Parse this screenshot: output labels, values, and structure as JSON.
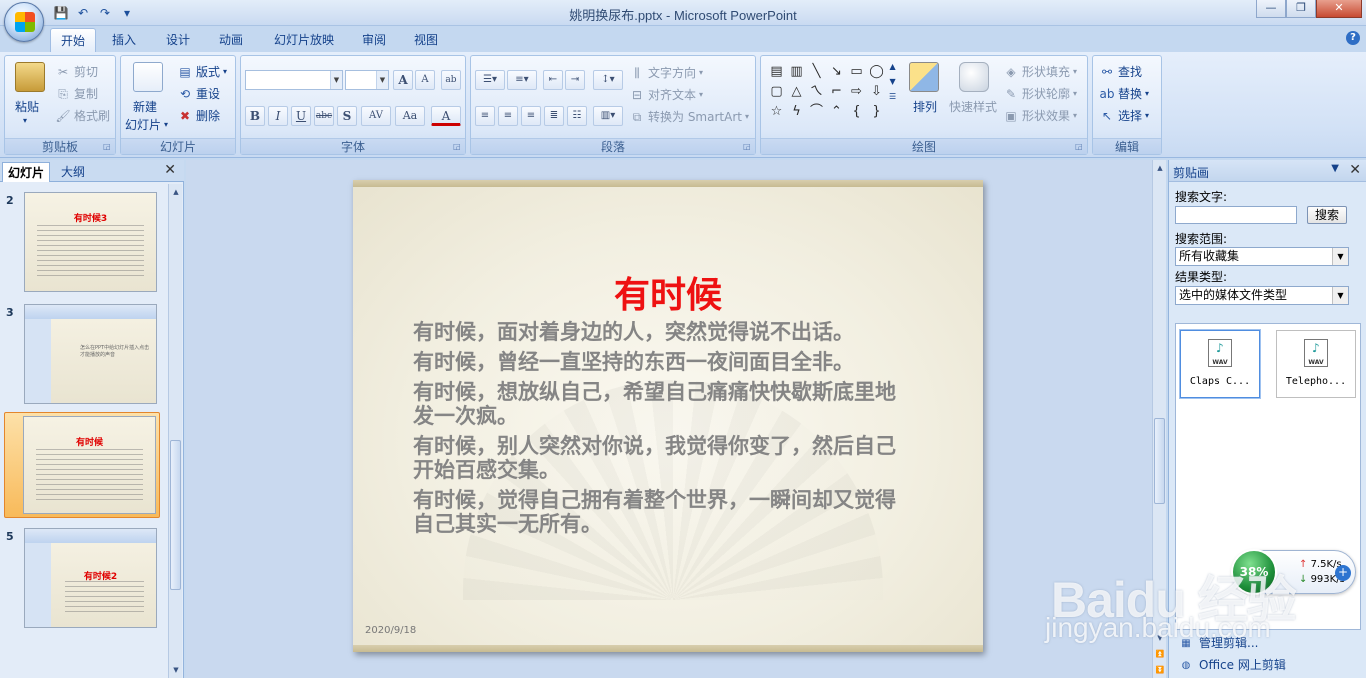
{
  "window": {
    "title": "姚明换尿布.pptx - Microsoft PowerPoint",
    "controls": {
      "minimize": "—",
      "maximize": "❐",
      "close": "✕"
    }
  },
  "qat": {
    "save": "💾",
    "undo": "↶",
    "redo": "↷",
    "more": "▾"
  },
  "tabs": [
    "开始",
    "插入",
    "设计",
    "动画",
    "幻灯片放映",
    "审阅",
    "视图"
  ],
  "active_tab": "开始",
  "help": "?",
  "ribbon": {
    "clipboard": {
      "label": "剪贴板",
      "paste": "粘贴",
      "cut": "剪切",
      "copy": "复制",
      "format_painter": "格式刷"
    },
    "slides": {
      "label": "幻灯片",
      "new_slide_1": "新建",
      "new_slide_2": "幻灯片",
      "layout": "版式",
      "reset": "重设",
      "delete": "删除"
    },
    "font": {
      "label": "字体",
      "bold": "B",
      "italic": "I",
      "underline": "U",
      "strike": "abc",
      "shadow": "S",
      "spacing": "AV",
      "case": "Aa",
      "color": "A",
      "grow": "A",
      "shrink": "A"
    },
    "paragraph": {
      "label": "段落",
      "text_direction": "文字方向",
      "align_text": "对齐文本",
      "smartart": "转换为 SmartArt"
    },
    "drawing": {
      "label": "绘图",
      "arrange": "排列",
      "quick_styles": "快速样式",
      "shape_fill": "形状填充",
      "shape_outline": "形状轮廓",
      "shape_effects": "形状效果"
    },
    "editing": {
      "label": "编辑",
      "find": "查找",
      "replace": "替换",
      "select": "选择"
    }
  },
  "left_pane": {
    "tabs": [
      "幻灯片",
      "大纲"
    ],
    "close": "✕",
    "thumbnails": [
      {
        "num": "2",
        "title": "有时候3"
      },
      {
        "num": "3",
        "title": "怎么在PPT中给幻灯片插入点击才能播放的声音"
      },
      {
        "num": "4",
        "title": "有时候",
        "selected": true
      },
      {
        "num": "5",
        "title": "有时候2"
      }
    ]
  },
  "slide": {
    "title": "有时候",
    "paragraphs": [
      "有时候，面对着身边的人，突然觉得说不出话。",
      "有时候，曾经一直坚持的东西一夜间面目全非。",
      "有时候，想放纵自己，希望自己痛痛快快歇斯底里地发一次疯。",
      "有时候，别人突然对你说，我觉得你变了，然后自己开始百感交集。",
      "有时候，觉得自己拥有着整个世界，一瞬间却又觉得自己其实一无所有。"
    ],
    "date": "2020/9/18"
  },
  "clip_pane": {
    "title": "剪贴画",
    "menu": "▼",
    "close": "✕",
    "search_label": "搜索文字:",
    "search_value": "",
    "search_button": "搜索",
    "scope_label": "搜索范围:",
    "scope_value": "所有收藏集",
    "type_label": "结果类型:",
    "type_value": "选中的媒体文件类型",
    "results": [
      {
        "caption": "Claps C...",
        "badge": "WAV"
      },
      {
        "caption": "Telepho...",
        "badge": "WAV"
      }
    ],
    "link_manage": "管理剪辑...",
    "link_online": "Office 网上剪辑"
  },
  "net_widget": {
    "percent": "38%",
    "up": "7.5K/s",
    "down": "993K/s",
    "plus": "+"
  },
  "watermark": {
    "main": "Baidu 经验",
    "sub": "jingyan.baidu.com"
  }
}
